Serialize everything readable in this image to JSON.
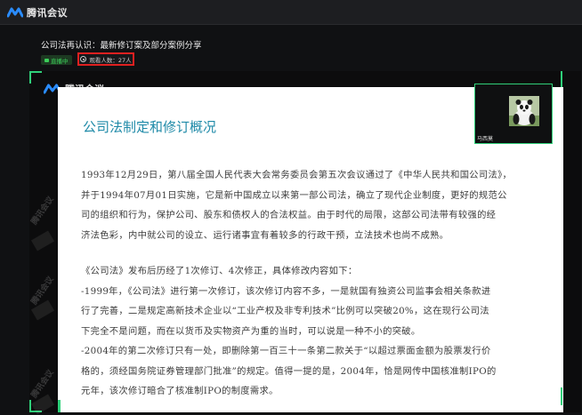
{
  "app": {
    "title": "腾讯会议"
  },
  "meeting": {
    "title": "公司法再认识：最新修订案及部分案例分享",
    "live_label": "直播中",
    "viewer_label": "观看人数：27人"
  },
  "stage": {
    "logo_text": "腾讯会议",
    "watermark": "腾讯会议"
  },
  "slide": {
    "heading": "公司法制定和修订概况",
    "para1": [
      "1993年12月29日，第八届全国人民代表大会常务委员会第五次会议通过了《中华人民共和国公司法》，",
      "并于1994年07月01日实施，它是新中国成立以来第一部公司法，确立了现代企业制度，更好的规范公",
      "司的组织和行为，保护公司、股东和债权人的合法权益。由于时代的局限，这部公司法带有较强的经",
      "济法色彩，内中就公司的设立、运行诸事宜有着较多的行政干预，立法技术也尚不成熟。"
    ],
    "para2": [
      "《公司法》发布后历经了1次修订、4次修正，具体修改内容如下：",
      "-1999年，《公司法》进行第一次修订，该次修订内容不多，一是就国有独资公司监事会相关条款进",
      "行了完善，二是规定高新技术企业以“工业产权及非专利技术”比例可以突破20%，这在现行公司法",
      "下完全不是问题，而在以货币及实物资产为重的当时，可以说是一种不小的突破。",
      "-2004年的第二次修订只有一处，即删除第一百三十一条第二款关于“以超过票面金额为股票发行价",
      "格的，须经国务院证券管理部门批准”的规定。值得一提的是，2004年，恰是网传中国核准制IPO的",
      "元年，该次修订暗合了核准制IPO的制度需求。"
    ]
  },
  "participant": {
    "name": "马西莫"
  },
  "colors": {
    "accent": "#2fd07a",
    "heading": "#1f8aa8",
    "highlight": "#e02020",
    "live": "#3bcf5a"
  }
}
